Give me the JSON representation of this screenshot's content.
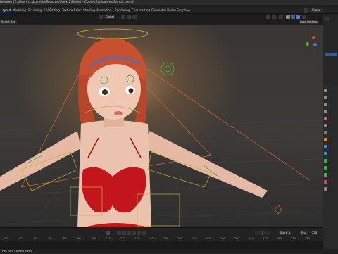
{
  "titlebar": {
    "title": "Blender [C:\\Users\\...\\Lovellia\\Reaches\\Pack 2\\Model - Copie (2)\\Sources\\Renda.blend]"
  },
  "workspace_tabs": [
    "Layout",
    "Modeling",
    "Sculpting",
    "UV Editing",
    "Texture Paint",
    "Shading",
    "Animation",
    "Rendering",
    "Compositing",
    "Geometry Nodes",
    "Scripting"
  ],
  "active_tab": "Layout",
  "scene": {
    "label": "Scene"
  },
  "viewport_header": {
    "select_box": "Select Box",
    "shading_mode": "Global",
    "pose_options": "Pose Options"
  },
  "timeline": {
    "ticks": [
      "40",
      "50",
      "60",
      "70",
      "80",
      "90",
      "100",
      "110",
      "120",
      "130",
      "140",
      "150",
      "160",
      "170",
      "180",
      "190",
      "200",
      "210",
      "220",
      "230",
      "240",
      "250"
    ],
    "current_frame": "1",
    "start_label": "Start",
    "start_value": "1",
    "end_label": "End",
    "end_value": "250"
  },
  "status": {
    "text": "Pan View    Context Menu"
  },
  "colors": {
    "accent": "#4d7fd0",
    "rig_yellow": "#c8b030",
    "rig_orange": "#d06a2a",
    "rig_green": "#3fae4a",
    "skin": "#eac2ad",
    "hair": "#c6502f",
    "bikini": "#c2161c"
  }
}
